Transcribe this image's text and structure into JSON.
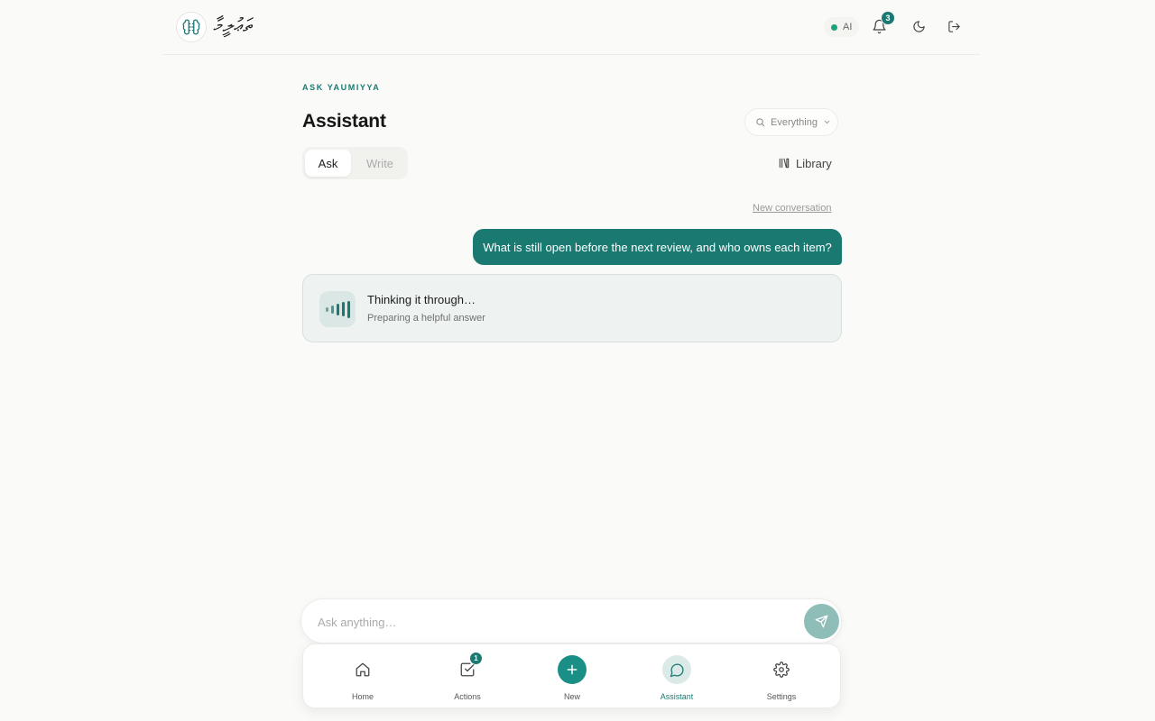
{
  "header": {
    "logo_text": "ތަޢުލީމާ",
    "ai_label": "AI",
    "notifications_count": "3"
  },
  "main": {
    "eyebrow": "ASK YAUMIYYA",
    "title": "Assistant",
    "scope_select": {
      "value": "Everything"
    },
    "mode_tabs": [
      {
        "label": "Ask",
        "active": true
      },
      {
        "label": "Write",
        "active": false
      }
    ],
    "library_label": "Library",
    "new_conversation_label": "New conversation"
  },
  "conversation": {
    "user_message": "What is still open before the next review, and who owns each item?",
    "thinking": {
      "title": "Thinking it through…",
      "subtitle": "Preparing a helpful answer"
    }
  },
  "composer": {
    "placeholder": "Ask anything…"
  },
  "bottom_nav": {
    "items": [
      {
        "label": "Home",
        "icon": "home-icon"
      },
      {
        "label": "Actions",
        "icon": "checkbox-icon",
        "badge": "1"
      },
      {
        "label": "New",
        "icon": "plus-icon"
      },
      {
        "label": "Assistant",
        "icon": "chat-bubble-icon",
        "active": true
      },
      {
        "label": "Settings",
        "icon": "gear-icon"
      }
    ]
  },
  "colors": {
    "accent": "#1a7a72",
    "background": "#fafaf8",
    "status_dot": "#1aa37a"
  }
}
